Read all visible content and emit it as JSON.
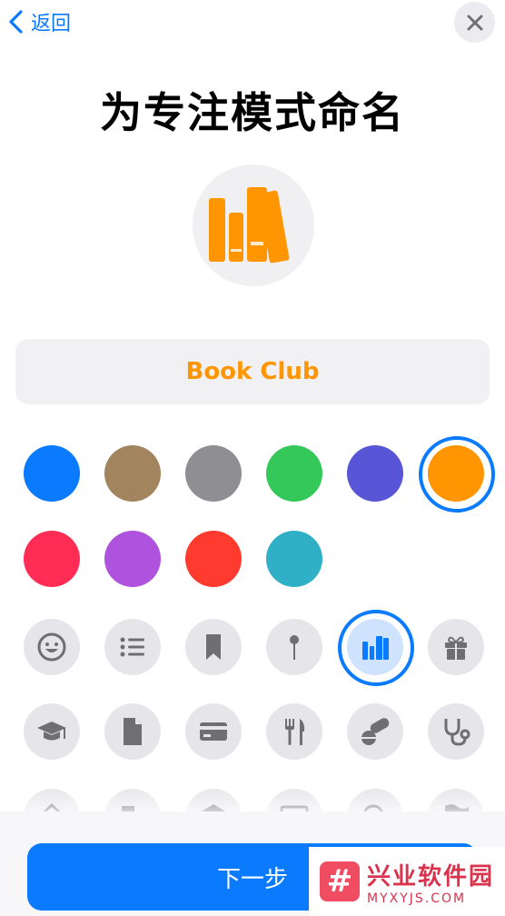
{
  "header": {
    "back_label": "返回",
    "back_icon": "chevron-left-icon",
    "close_icon": "xmark-icon"
  },
  "title": "为专注模式命名",
  "preview": {
    "icon": "books-icon",
    "color": "#ff9500"
  },
  "name_field": {
    "value": "Book Club",
    "placeholder": ""
  },
  "colors": {
    "options": [
      "#0a7aff",
      "#a2845e",
      "#8e8e93",
      "#34c759",
      "#5856d6",
      "#ff9500",
      "#ff2d55",
      "#af52de",
      "#ff3b30",
      "#30b0c7"
    ],
    "selected": "#ff9500"
  },
  "icons": {
    "rows": [
      [
        "smiley-icon",
        "list-icon",
        "bookmark-icon",
        "pin-icon",
        "books-icon",
        "gift-icon"
      ],
      [
        "graduation-cap-icon",
        "document-icon",
        "credit-card-icon",
        "fork-knife-icon",
        "pills-icon",
        "stethoscope-icon"
      ],
      [
        "house-icon",
        "building-icon",
        "bank-icon",
        "tv-icon",
        "magnifier-icon",
        "flag-icon"
      ]
    ],
    "selected": "books-icon"
  },
  "next_button": {
    "label": "下一步"
  },
  "watermark": {
    "cn": "兴业软件园",
    "en": "MYXYJS.COM",
    "logo": "#"
  }
}
